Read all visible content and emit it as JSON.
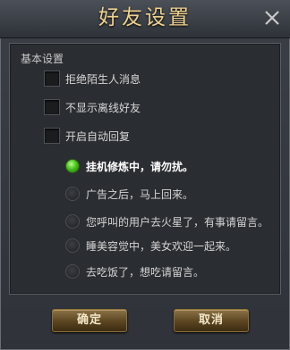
{
  "window": {
    "title": "好友设置"
  },
  "section": {
    "label": "基本设置"
  },
  "checkboxes": [
    {
      "label": "拒绝陌生人消息",
      "checked": false
    },
    {
      "label": "不显示离线好友",
      "checked": false
    },
    {
      "label": "开启自动回复",
      "checked": false
    }
  ],
  "auto_replies": [
    {
      "label": "挂机修炼中，请勿扰。",
      "selected": true
    },
    {
      "label": "广告之后，马上回来。",
      "selected": false
    },
    {
      "label": "您呼叫的用户去火星了，有事请留言。",
      "selected": false
    },
    {
      "label": "睡美容觉中，美女欢迎一起来。",
      "selected": false
    },
    {
      "label": "去吃饭了，想吃请留言。",
      "selected": false
    }
  ],
  "buttons": {
    "confirm": "确定",
    "cancel": "取消"
  },
  "colors": {
    "title": "#efd28e",
    "selected_radio": "#48c21e"
  }
}
